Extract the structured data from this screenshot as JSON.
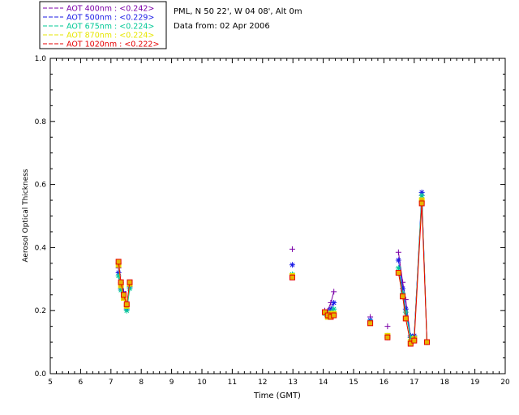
{
  "header": {
    "site_line": "PML, N 50 22', W 04 08', Alt 0m",
    "date_line": "Data from: 02 Apr 2006"
  },
  "chart_data": {
    "type": "scatter",
    "title": "",
    "xlabel": "Time (GMT)",
    "ylabel": "Aerosol Optical Thickness",
    "xlim": [
      5,
      20
    ],
    "ylim": [
      0.0,
      1.0
    ],
    "xticks": [
      "5",
      "6",
      "7",
      "8",
      "9",
      "10",
      "11",
      "12",
      "13",
      "14",
      "15",
      "16",
      "17",
      "18",
      "19",
      "20"
    ],
    "yticks": [
      "0.0",
      "0.2",
      "0.4",
      "0.6",
      "0.8",
      "1.0"
    ],
    "grid": false,
    "legend_position": "top-left, outside plot",
    "series": [
      {
        "name": "AOT 400nm",
        "legend_label": "AOT  400nm : <0.242>",
        "color": "#7b00a8",
        "marker": "plus",
        "segments": [
          [
            [
              7.25,
              0.335
            ],
            [
              7.33,
              0.29
            ],
            [
              7.42,
              0.26
            ],
            [
              7.52,
              0.215
            ],
            [
              7.62,
              0.28
            ]
          ],
          [
            [
              12.98,
              0.395
            ]
          ],
          [
            [
              14.05,
              0.2
            ],
            [
              14.15,
              0.2
            ],
            [
              14.25,
              0.225
            ],
            [
              14.35,
              0.26
            ]
          ],
          [
            [
              15.55,
              0.18
            ]
          ],
          [
            [
              16.12,
              0.15
            ]
          ],
          [
            [
              16.48,
              0.385
            ],
            [
              16.62,
              0.29
            ],
            [
              16.72,
              0.235
            ],
            [
              16.88,
              0.115
            ],
            [
              17.0,
              0.12
            ],
            [
              17.25,
              0.565
            ],
            [
              17.42,
              0.1
            ]
          ]
        ]
      },
      {
        "name": "AOT 500nm",
        "legend_label": "AOT  500nm : <0.229>",
        "color": "#1a1ae6",
        "marker": "asterisk",
        "segments": [
          [
            [
              7.25,
              0.32
            ],
            [
              7.33,
              0.27
            ],
            [
              7.42,
              0.255
            ],
            [
              7.52,
              0.205
            ],
            [
              7.62,
              0.275
            ]
          ],
          [
            [
              12.98,
              0.345
            ]
          ],
          [
            [
              14.05,
              0.195
            ],
            [
              14.15,
              0.19
            ],
            [
              14.25,
              0.205
            ],
            [
              14.35,
              0.225
            ]
          ],
          [
            [
              15.55,
              0.17
            ]
          ],
          [
            [
              16.12,
              0.12
            ]
          ],
          [
            [
              16.48,
              0.36
            ],
            [
              16.62,
              0.27
            ],
            [
              16.72,
              0.205
            ],
            [
              16.88,
              0.12
            ],
            [
              17.0,
              0.12
            ],
            [
              17.25,
              0.575
            ],
            [
              17.42,
              0.1
            ]
          ]
        ]
      },
      {
        "name": "AOT 675nm",
        "legend_label": "AOT  675nm : <0.224>",
        "color": "#00c896",
        "marker": "asterisk",
        "segments": [
          [
            [
              7.25,
              0.31
            ],
            [
              7.33,
              0.265
            ],
            [
              7.42,
              0.245
            ],
            [
              7.52,
              0.2
            ],
            [
              7.62,
              0.27
            ]
          ],
          [
            [
              12.98,
              0.315
            ]
          ],
          [
            [
              14.05,
              0.19
            ],
            [
              14.15,
              0.185
            ],
            [
              14.25,
              0.195
            ],
            [
              14.35,
              0.205
            ]
          ],
          [
            [
              15.55,
              0.165
            ]
          ],
          [
            [
              16.12,
              0.115
            ]
          ],
          [
            [
              16.48,
              0.335
            ],
            [
              16.62,
              0.255
            ],
            [
              16.72,
              0.195
            ],
            [
              16.88,
              0.115
            ],
            [
              17.0,
              0.115
            ],
            [
              17.25,
              0.565
            ],
            [
              17.42,
              0.1
            ]
          ]
        ]
      },
      {
        "name": "AOT 870nm",
        "legend_label": "AOT  870nm : <0.224>",
        "color": "#e6e600",
        "marker": "square",
        "segments": [
          [
            [
              7.25,
              0.345
            ],
            [
              7.33,
              0.28
            ],
            [
              7.42,
              0.24
            ],
            [
              7.52,
              0.215
            ],
            [
              7.62,
              0.285
            ]
          ],
          [
            [
              12.98,
              0.31
            ]
          ],
          [
            [
              14.05,
              0.195
            ],
            [
              14.15,
              0.18
            ],
            [
              14.25,
              0.19
            ],
            [
              14.35,
              0.19
            ]
          ],
          [
            [
              15.55,
              0.16
            ]
          ],
          [
            [
              16.12,
              0.12
            ]
          ],
          [
            [
              16.48,
              0.32
            ],
            [
              16.62,
              0.245
            ],
            [
              16.72,
              0.175
            ],
            [
              16.88,
              0.1
            ],
            [
              17.0,
              0.11
            ],
            [
              17.25,
              0.55
            ],
            [
              17.42,
              0.1
            ]
          ]
        ]
      },
      {
        "name": "AOT 1020nm",
        "legend_label": "AOT 1020nm : <0.222>",
        "color": "#e60000",
        "marker": "square",
        "segments": [
          [
            [
              7.25,
              0.355
            ],
            [
              7.33,
              0.29
            ],
            [
              7.42,
              0.25
            ],
            [
              7.52,
              0.22
            ],
            [
              7.62,
              0.29
            ]
          ],
          [
            [
              12.98,
              0.305
            ]
          ],
          [
            [
              14.05,
              0.195
            ],
            [
              14.15,
              0.185
            ],
            [
              14.25,
              0.18
            ],
            [
              14.35,
              0.185
            ]
          ],
          [
            [
              15.55,
              0.16
            ]
          ],
          [
            [
              16.12,
              0.115
            ]
          ],
          [
            [
              16.48,
              0.32
            ],
            [
              16.62,
              0.245
            ],
            [
              16.72,
              0.175
            ],
            [
              16.88,
              0.095
            ],
            [
              17.0,
              0.105
            ],
            [
              17.25,
              0.54
            ],
            [
              17.42,
              0.1
            ]
          ]
        ]
      }
    ]
  }
}
